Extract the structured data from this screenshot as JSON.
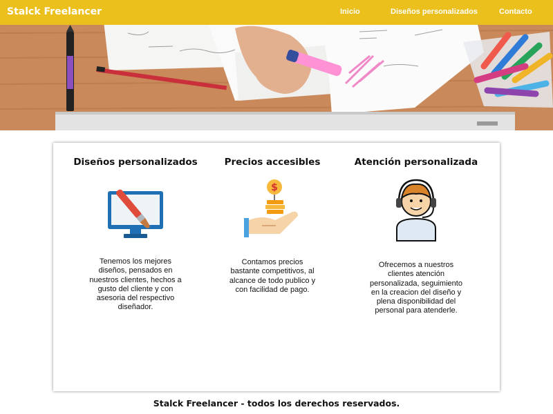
{
  "header": {
    "brand": "Stalck Freelancer",
    "nav": [
      {
        "label": "Inicio"
      },
      {
        "label": "Diseños personalizados"
      },
      {
        "label": "Contacto"
      }
    ],
    "bar_color": "#ebc01c"
  },
  "features": [
    {
      "title": "Diseños personalizados",
      "icon": "monitor-paintbrush-icon",
      "text": "Tenemos los mejores diseños, pensados en nuestros clientes, hechos a gusto del cliente y con asesoria del respectivo diseñador."
    },
    {
      "title": "Precios accesibles",
      "icon": "hand-coins-icon",
      "text": "Contamos precios bastante competitivos, al alcance de todo publico y con facilidad de pago."
    },
    {
      "title": "Atención personalizada",
      "icon": "support-agent-icon",
      "text": "Ofrecemos a nuestros clientes atención personalizada, seguimiento en la creacion del diseño y plena disponibilidad del personal para atenderle."
    }
  ],
  "footer": {
    "text": "Stalck Freelancer - todos los derechos reservados."
  }
}
